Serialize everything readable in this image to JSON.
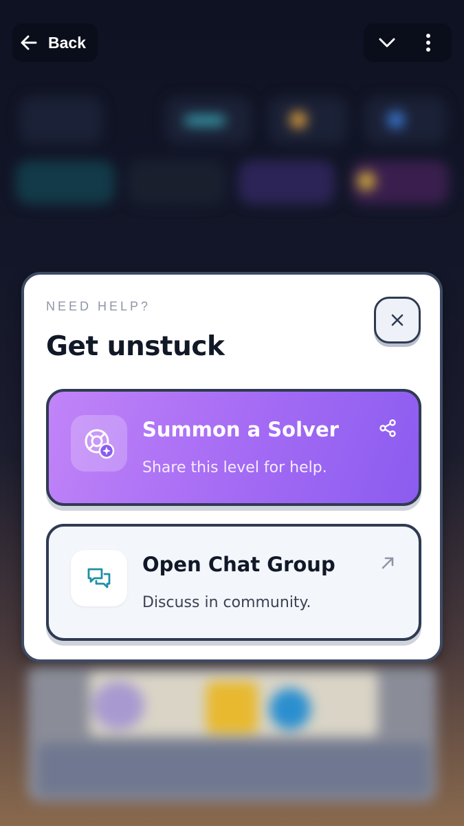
{
  "topbar": {
    "back_label": "Back",
    "back_icon": "arrow-left-icon",
    "dropdown_icon": "chevron-down-icon",
    "menu_icon": "more-vertical-icon"
  },
  "modal": {
    "eyebrow": "NEED HELP?",
    "title": "Get unstuck",
    "close_icon": "close-icon",
    "options": [
      {
        "title": "Summon a Solver",
        "subtitle": "Share this level for help.",
        "icon": "lifebuoy-sparkle-icon",
        "corner_icon": "share-icon"
      },
      {
        "title": "Open Chat Group",
        "subtitle": "Discuss in community.",
        "icon": "chat-bubbles-icon",
        "corner_icon": "external-arrow-icon"
      }
    ]
  },
  "colors": {
    "solver_gradient_start": "#c184f8",
    "solver_gradient_end": "#8b5cf0",
    "modal_border": "#3e4a64",
    "chat_card_bg": "#f3f6fb"
  }
}
